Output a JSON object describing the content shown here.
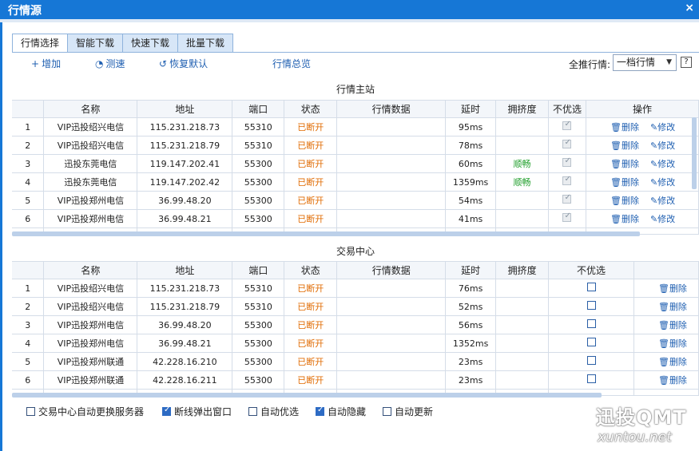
{
  "window": {
    "title": "行情源",
    "close": "×"
  },
  "tabs": [
    "行情选择",
    "智能下载",
    "快速下载",
    "批量下载"
  ],
  "toolbar": {
    "add": "增加",
    "speed_test": "测速",
    "reset": "恢复默认",
    "summary": "行情总览",
    "filter_label": "全推行情:",
    "filter_value": "一档行情",
    "help": "?"
  },
  "market": {
    "title": "行情主站",
    "columns": [
      "",
      "名称",
      "地址",
      "端口",
      "状态",
      "行情数据",
      "延时",
      "拥挤度",
      "不优选",
      "操作"
    ],
    "rows": [
      {
        "idx": "1",
        "name": "VIP迅投绍兴电信",
        "addr": "115.231.218.73",
        "port": "55310",
        "status": "已断开",
        "data": "",
        "delay": "95ms",
        "crowd": "",
        "nopref": true
      },
      {
        "idx": "2",
        "name": "VIP迅投绍兴电信",
        "addr": "115.231.218.79",
        "port": "55310",
        "status": "已断开",
        "data": "",
        "delay": "78ms",
        "crowd": "",
        "nopref": true
      },
      {
        "idx": "3",
        "name": "迅投东莞电信",
        "addr": "119.147.202.41",
        "port": "55300",
        "status": "已断开",
        "data": "",
        "delay": "60ms",
        "crowd": "顺畅",
        "nopref": true
      },
      {
        "idx": "4",
        "name": "迅投东莞电信",
        "addr": "119.147.202.42",
        "port": "55300",
        "status": "已断开",
        "data": "",
        "delay": "1359ms",
        "crowd": "顺畅",
        "nopref": true
      },
      {
        "idx": "5",
        "name": "VIP迅投郑州电信",
        "addr": "36.99.48.20",
        "port": "55300",
        "status": "已断开",
        "data": "",
        "delay": "54ms",
        "crowd": "",
        "nopref": true
      },
      {
        "idx": "6",
        "name": "VIP迅投郑州电信",
        "addr": "36.99.48.21",
        "port": "55300",
        "status": "已断开",
        "data": "",
        "delay": "41ms",
        "crowd": "",
        "nopref": true
      }
    ],
    "delete": "删除",
    "edit": "修改"
  },
  "trade": {
    "title": "交易中心",
    "columns": [
      "",
      "名称",
      "地址",
      "端口",
      "状态",
      "行情数据",
      "延时",
      "拥挤度",
      "不优选",
      ""
    ],
    "rows": [
      {
        "idx": "1",
        "name": "VIP迅投绍兴电信",
        "addr": "115.231.218.73",
        "port": "55310",
        "status": "已断开",
        "data": "",
        "delay": "76ms",
        "crowd": "",
        "nopref": false
      },
      {
        "idx": "2",
        "name": "VIP迅投绍兴电信",
        "addr": "115.231.218.79",
        "port": "55310",
        "status": "已断开",
        "data": "",
        "delay": "52ms",
        "crowd": "",
        "nopref": false
      },
      {
        "idx": "3",
        "name": "VIP迅投郑州电信",
        "addr": "36.99.48.20",
        "port": "55300",
        "status": "已断开",
        "data": "",
        "delay": "56ms",
        "crowd": "",
        "nopref": false
      },
      {
        "idx": "4",
        "name": "VIP迅投郑州电信",
        "addr": "36.99.48.21",
        "port": "55300",
        "status": "已断开",
        "data": "",
        "delay": "1352ms",
        "crowd": "",
        "nopref": false
      },
      {
        "idx": "5",
        "name": "VIP迅投郑州联通",
        "addr": "42.228.16.210",
        "port": "55300",
        "status": "已断开",
        "data": "",
        "delay": "23ms",
        "crowd": "",
        "nopref": false
      },
      {
        "idx": "6",
        "name": "VIP迅投郑州联通",
        "addr": "42.228.16.211",
        "port": "55300",
        "status": "已断开",
        "data": "",
        "delay": "23ms",
        "crowd": "",
        "nopref": false
      }
    ],
    "delete": "删除"
  },
  "options": [
    {
      "label": "交易中心自动更换服务器",
      "checked": false
    },
    {
      "label": "断线弹出窗口",
      "checked": true
    },
    {
      "label": "自动优选",
      "checked": false
    },
    {
      "label": "自动隐藏",
      "checked": true
    },
    {
      "label": "自动更新",
      "checked": false
    }
  ],
  "watermark": {
    "big": "迅投QMT",
    "small": "xuntou.net"
  }
}
